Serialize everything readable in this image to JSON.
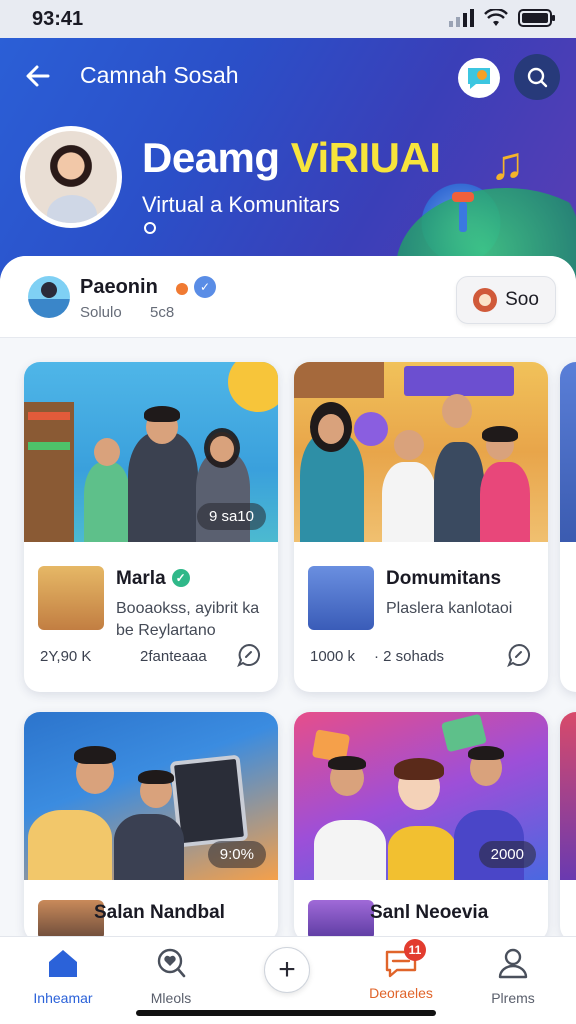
{
  "status_bar": {
    "time": "93:41"
  },
  "header": {
    "title": "Camnah Sosah",
    "hero_title_main": "Deamg ",
    "hero_title_accent": "ViRIUAI",
    "hero_subtitle": "Virtual a Komunitars",
    "accent_color": "#f7e43c"
  },
  "profile": {
    "name": "Paeonin",
    "stat_label": "Solulo",
    "stat_value": "5c8",
    "follow_label": "Soo"
  },
  "cards": [
    {
      "badge": "9 sa10",
      "title": "Marla",
      "verified": true,
      "desc": "Booaokss, ayibrit ka be Reylartano",
      "meta_left": "2Y,90 K",
      "meta_right": "2fanteaaa"
    },
    {
      "badge": "",
      "title": "Domumitans",
      "verified": false,
      "desc": "Plaslera kanlotaoi",
      "meta_left": "1000 k",
      "meta_right": "· 2 sohads"
    },
    {
      "badge": "9:0%",
      "title": "Salan Nandbal",
      "verified": false,
      "desc": "",
      "meta_left": "",
      "meta_right": ""
    },
    {
      "badge": "2000",
      "title": "Sanl Neoevia",
      "verified": false,
      "desc": "",
      "meta_left": "",
      "meta_right": ""
    }
  ],
  "bottom_nav": [
    {
      "label": "Inheamar",
      "icon": "home-icon",
      "active": true
    },
    {
      "label": "Mleols",
      "icon": "heart-search-icon"
    },
    {
      "label": "",
      "icon": "plus-icon"
    },
    {
      "label": "Deoraeles",
      "icon": "message-icon",
      "badge": "11"
    },
    {
      "label": "Plrems",
      "icon": "person-icon"
    }
  ]
}
